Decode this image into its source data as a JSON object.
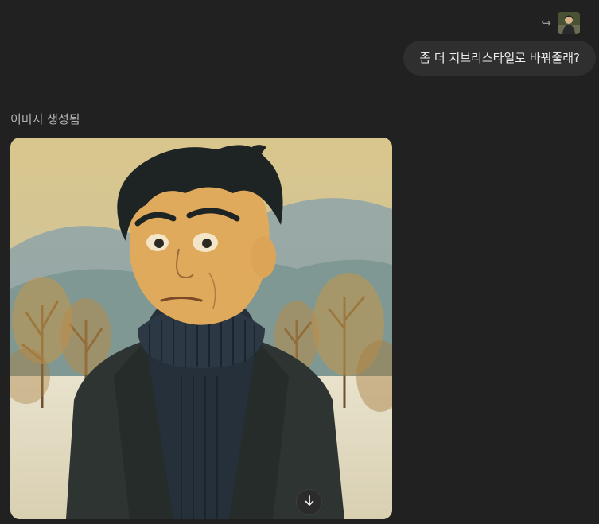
{
  "conversation": {
    "user_message": {
      "text": "좀 더 지브리스타일로 바꿔줄래?",
      "reply_icon": "reply-arrow-icon",
      "avatar_icon": "user-avatar"
    },
    "assistant": {
      "status_label": "이미지 생성됨",
      "image": {
        "description_icon": "generated-image",
        "download_icon": "arrow-down-icon"
      }
    }
  },
  "colors": {
    "background": "#212121",
    "bubble": "#2f2f2f",
    "text": "#ececec",
    "muted_text": "#b4b4b4"
  }
}
